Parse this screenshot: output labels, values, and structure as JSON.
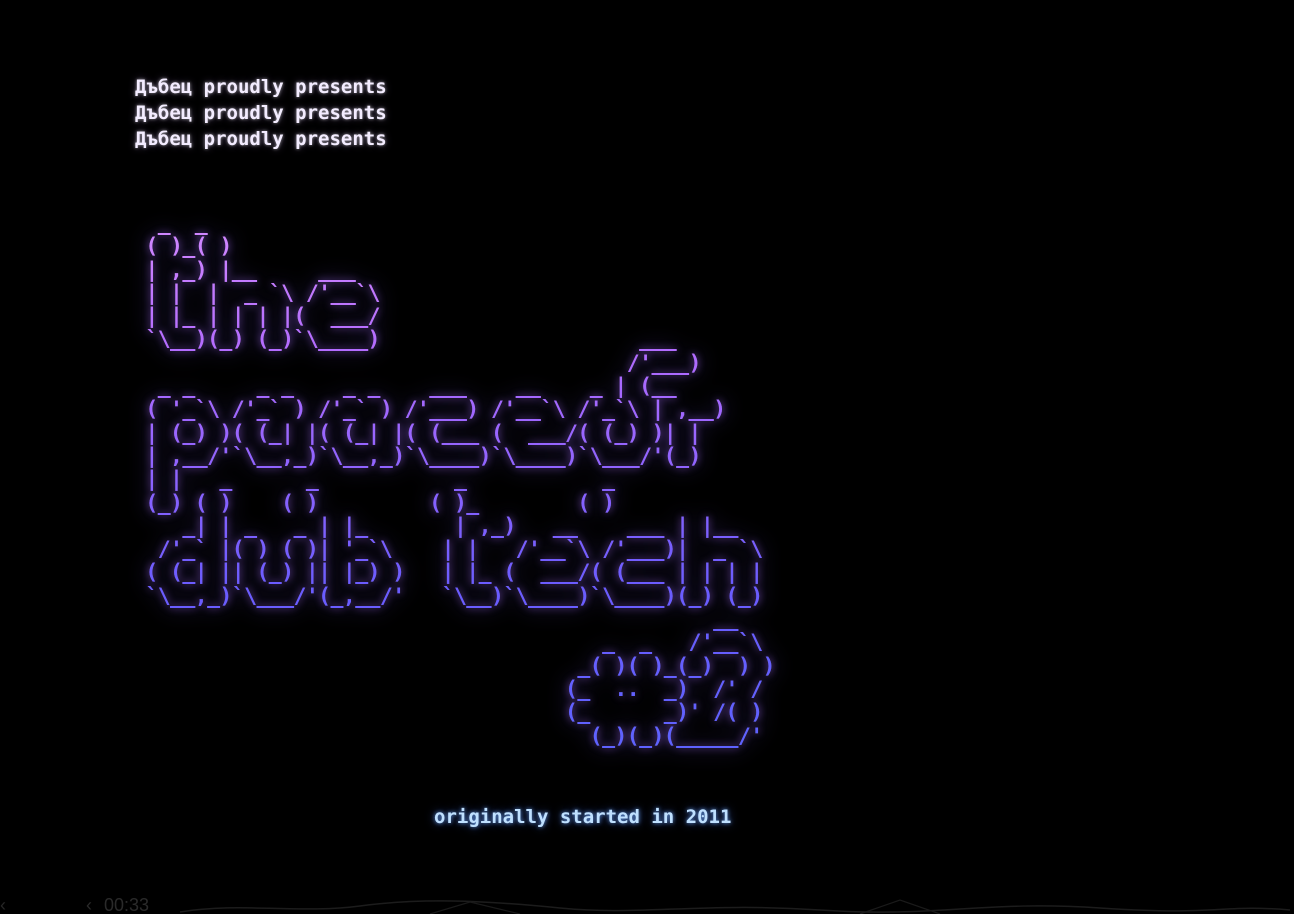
{
  "intro": {
    "lines": [
      "Дъбец proudly presents",
      "Дъбец proudly presents",
      "Дъбец proudly presents"
    ]
  },
  "banner": {
    "ascii_art": "  _  _\n ( )_( )\n | ,_) |__     ___\n | |  |  _ `\\ /'__`\\\n | |_ | | | |(  ___/\n `\\__)(_) (_)`\\____)                     ___\n                                        /'___)\n  _ _     _ _    _ _    ___    __    _ | (__\n ( '_`\\ /'_` ) /'_` ) /'___) /'__`\\ /'_`\\ | ,__)\n | (_) )( (_| |( (_| |( (___ (  ___/( (_) )| |\n | ,__/'`\\__,_)`\\__,_)`\\____)`\\____)`\\___/'(_)\n | |   _      _           _           _\n (_) ( )    ( )         ( )_        ( )\n    _| | _   _ | |_       | ,_)   __    ___ | |__\n  /'_` |( ) ( )| '_`\\    | |   /'__`\\ /'___)|  _ `\\\n ( (_| || (_) || |_) )   | |_ (  ___/( (___ | | | |\n `\\__,_)`\\___/'(_,__/'   `\\__)`\\____)`\\____)(_) (_)\n                                               __\n                                      _  _   /'__`\\\n                                    _( )( )_(_)  ) )\n                                   (_  ..  _)  /' /\n                                   (_      _)' /( )\n                                     (_)(_)(_____/'"
  },
  "footer_text": "originally started in 2011",
  "player": {
    "timecode": "00:33",
    "back_icon": "chevron-left-icon"
  },
  "colors": {
    "background": "#000000",
    "intro_text": "#f3ecff",
    "ascii_top": "#d58bff",
    "ascii_bottom": "#5e62ff",
    "footer_text": "#bfe0ff"
  }
}
